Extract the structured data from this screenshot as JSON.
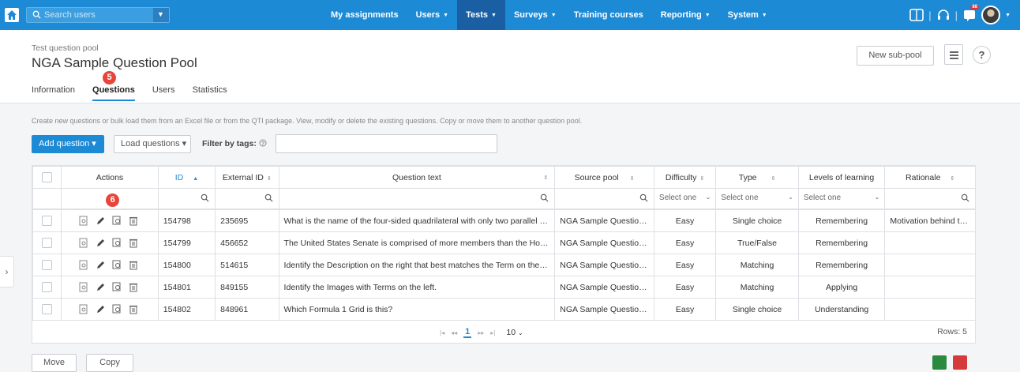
{
  "nav": {
    "search_placeholder": "Search users",
    "items": [
      {
        "label": "My assignments",
        "caret": ""
      },
      {
        "label": "Users",
        "caret": "▼"
      },
      {
        "label": "Tests",
        "caret": "▼"
      },
      {
        "label": "Surveys",
        "caret": "▼"
      },
      {
        "label": "Training courses",
        "caret": ""
      },
      {
        "label": "Reporting",
        "caret": "▼"
      },
      {
        "label": "System",
        "caret": "▼"
      }
    ],
    "active_item": "Tests",
    "notification_count": "88"
  },
  "header": {
    "breadcrumb": "Test question pool",
    "title": "NGA Sample Question Pool",
    "tabs": [
      "Information",
      "Questions",
      "Users",
      "Statistics"
    ],
    "active_tab": "Questions",
    "new_subpool_label": "New sub-pool",
    "help_label": "?"
  },
  "step_badges": [
    "5",
    "6"
  ],
  "hint": "Create new questions or bulk load them from an Excel file or from the QTI package. View, modify or delete the existing questions. Copy or move them to another question pool.",
  "toolbar": {
    "add_question_label": "Add question ▾",
    "load_questions_label": "Load questions ▾",
    "filter_label": "Filter by tags:",
    "filter_value": ""
  },
  "grid": {
    "columns": [
      "Actions",
      "ID",
      "External ID",
      "Question text",
      "Source pool",
      "Difficulty",
      "Type",
      "Levels of learning",
      "Rationale"
    ],
    "sort_marks": {
      "ID": "▲",
      "other": "⇕"
    },
    "select_placeholder": "Select one",
    "rows": [
      {
        "id": "154798",
        "external_id": "235695",
        "question": "What is the name of the four-sided quadrilateral with only two parallel sides?",
        "source_pool": "NGA Sample Question Pool",
        "difficulty": "Easy",
        "type": "Single choice",
        "level": "Remembering",
        "rationale": "Motivation behind the answer"
      },
      {
        "id": "154799",
        "external_id": "456652",
        "question": "The United States Senate is comprised of more members than the House of Representatives.",
        "source_pool": "NGA Sample Question Pool",
        "difficulty": "Easy",
        "type": "True/False",
        "level": "Remembering",
        "rationale": ""
      },
      {
        "id": "154800",
        "external_id": "514615",
        "question": "Identify the Description on the right that best matches the Term on the left.",
        "source_pool": "NGA Sample Question Pool",
        "difficulty": "Easy",
        "type": "Matching",
        "level": "Remembering",
        "rationale": ""
      },
      {
        "id": "154801",
        "external_id": "849155",
        "question": "Identify the Images with Terms on the left.",
        "source_pool": "NGA Sample Question Pool",
        "difficulty": "Easy",
        "type": "Matching",
        "level": "Applying",
        "rationale": ""
      },
      {
        "id": "154802",
        "external_id": "848961",
        "question": "Which Formula 1 Grid is this?",
        "source_pool": "NGA Sample Question Pool",
        "difficulty": "Easy",
        "type": "Single choice",
        "level": "Understanding",
        "rationale": ""
      }
    ],
    "pager": {
      "current_page": "1",
      "page_size": "10",
      "rows_label": "Rows: 5"
    }
  },
  "footer": {
    "move_label": "Move",
    "copy_label": "Copy"
  },
  "colors": {
    "accent": "#1d8ad6",
    "nav_active": "#1a5fa3",
    "badge": "#e8443a"
  }
}
